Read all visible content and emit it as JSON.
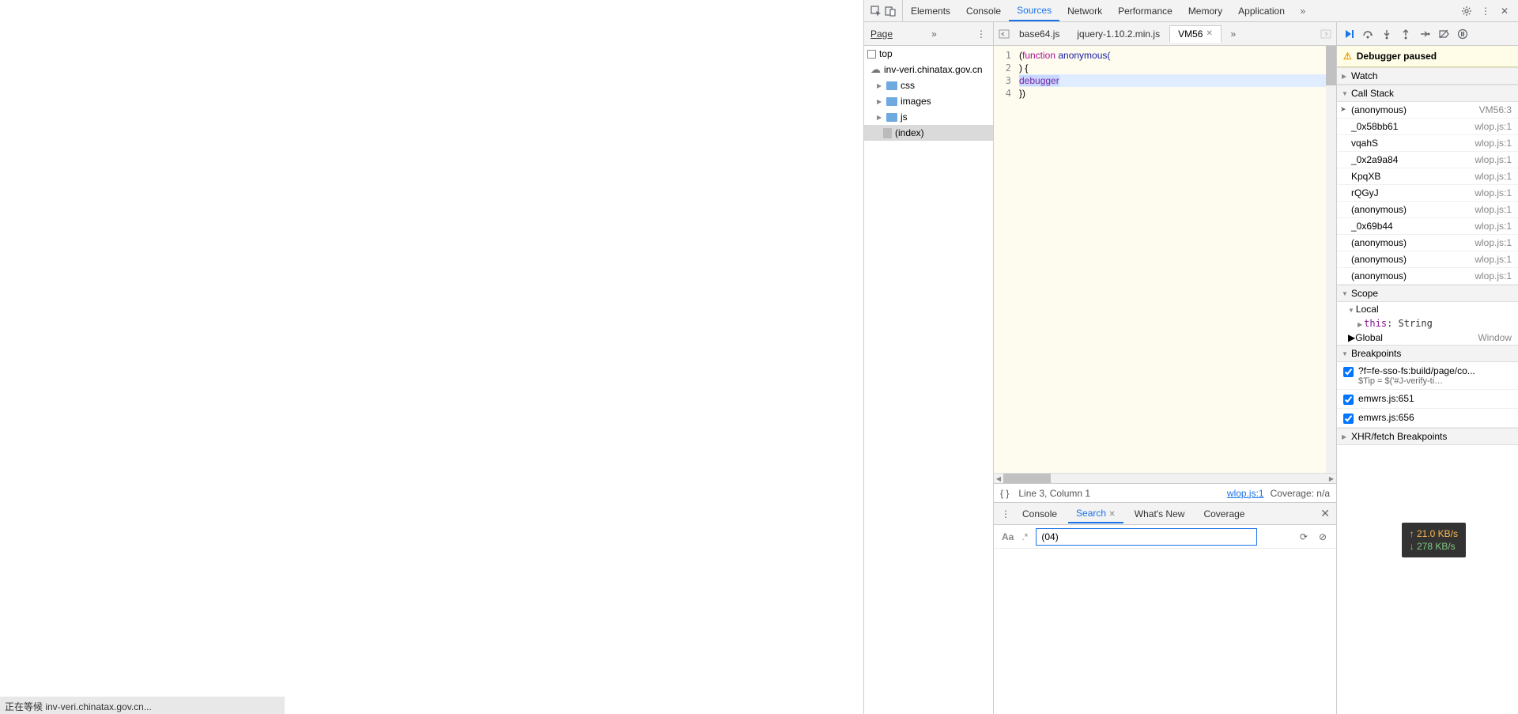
{
  "status_bar": "正在等候 inv-veri.chinatax.gov.cn...",
  "devtools_tabs": [
    "Elements",
    "Console",
    "Sources",
    "Network",
    "Performance",
    "Memory",
    "Application"
  ],
  "devtools_active_tab": "Sources",
  "sources": {
    "page_tab": "Page",
    "tree": {
      "top": "top",
      "domain": "inv-veri.chinatax.gov.cn",
      "folders": [
        "css",
        "images",
        "js"
      ],
      "index": "(index)"
    },
    "file_tabs": [
      {
        "name": "base64.js",
        "active": false
      },
      {
        "name": "jquery-1.10.2.min.js",
        "active": false
      },
      {
        "name": "VM56",
        "active": true
      }
    ],
    "code_lines": {
      "l1": "(",
      "l1k": "function",
      "l1b": " anonymous(",
      "l2": ") {",
      "l3": "debugger",
      "l4": "})"
    },
    "footer": {
      "cursor": "Line 3, Column 1",
      "link": "wlop.js:1",
      "coverage": "Coverage: n/a"
    }
  },
  "debugger": {
    "toolbar": {
      "resume": "▶",
      "step_over": "↷",
      "step_into": "↓",
      "step_out": "↑",
      "step": "→",
      "deactivate": "⊘",
      "pause_exc": "⏸"
    },
    "banner": "Debugger paused",
    "sections": {
      "watch": "Watch",
      "callstack": "Call Stack",
      "scope": "Scope",
      "breakpoints": "Breakpoints",
      "xhr": "XHR/fetch Breakpoints"
    },
    "callstack": [
      {
        "fn": "(anonymous)",
        "loc": "VM56:3",
        "active": true
      },
      {
        "fn": "_0x58bb61",
        "loc": "wlop.js:1"
      },
      {
        "fn": "vqahS",
        "loc": "wlop.js:1"
      },
      {
        "fn": "_0x2a9a84",
        "loc": "wlop.js:1"
      },
      {
        "fn": "KpqXB",
        "loc": "wlop.js:1"
      },
      {
        "fn": "rQGyJ",
        "loc": "wlop.js:1"
      },
      {
        "fn": "(anonymous)",
        "loc": "wlop.js:1"
      },
      {
        "fn": "_0x69b44",
        "loc": "wlop.js:1"
      },
      {
        "fn": "(anonymous)",
        "loc": "wlop.js:1"
      },
      {
        "fn": "(anonymous)",
        "loc": "wlop.js:1"
      },
      {
        "fn": "(anonymous)",
        "loc": "wlop.js:1"
      }
    ],
    "scope": {
      "local": "Local",
      "this_label": "this",
      "this_type": ": String",
      "global": "Global",
      "global_val": "Window"
    },
    "breakpoints": [
      {
        "label": "?f=fe-sso-fs:build/page/co...",
        "sub": "$Tip = $('#J-verify-ti…",
        "checked": true
      },
      {
        "label": "emwrs.js:651",
        "checked": true
      },
      {
        "label": "emwrs.js:656",
        "checked": true
      }
    ]
  },
  "drawer": {
    "tabs": [
      "Console",
      "Search",
      "What's New",
      "Coverage"
    ],
    "active": "Search",
    "search_value": "(04)"
  },
  "net_overlay": {
    "up": "21.0 KB/s",
    "down": "278 KB/s"
  }
}
